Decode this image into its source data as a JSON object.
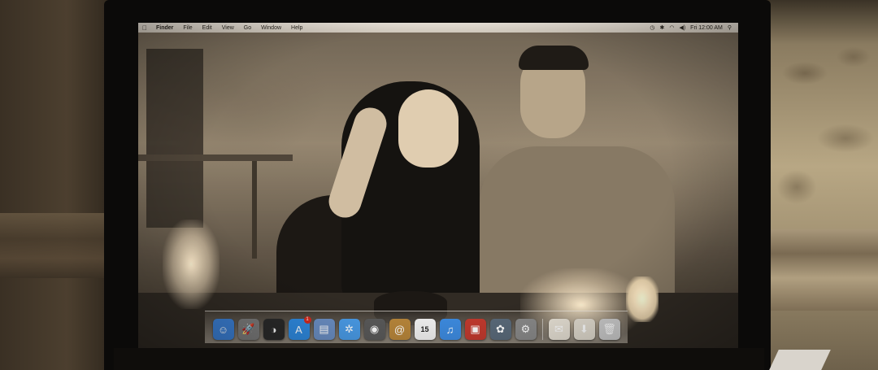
{
  "menubar": {
    "apple_icon": "apple-logo-icon",
    "items": [
      "Finder",
      "File",
      "Edit",
      "View",
      "Go",
      "Window",
      "Help"
    ],
    "status": {
      "clock": "Fri 12:00 AM",
      "icons": [
        "time-machine-icon",
        "bluetooth-icon",
        "wifi-icon",
        "volume-icon",
        "spotlight-icon"
      ]
    }
  },
  "wallpaper": {
    "description_icon": "photo-wallpaper"
  },
  "dock": {
    "items": [
      {
        "name": "finder",
        "icon": "☺",
        "color": "#3b7fd4"
      },
      {
        "name": "launchpad",
        "icon": "🚀",
        "color": "#7a7a7a"
      },
      {
        "name": "dashboard",
        "icon": "◑",
        "color": "#2a2a2a"
      },
      {
        "name": "app-store",
        "icon": "A",
        "color": "#2f8ae0",
        "badge": "1"
      },
      {
        "name": "preview",
        "icon": "▤",
        "color": "#6b8fc4"
      },
      {
        "name": "safari",
        "icon": "✲",
        "color": "#4a9ce8"
      },
      {
        "name": "facetime",
        "icon": "◉",
        "color": "#5a5a5a"
      },
      {
        "name": "contacts",
        "icon": "@",
        "color": "#b8863a"
      },
      {
        "name": "calendar",
        "icon": "15",
        "color": "#f1f1f1"
      },
      {
        "name": "itunes",
        "icon": "♫",
        "color": "#3d8be0"
      },
      {
        "name": "photo-booth",
        "icon": "▣",
        "color": "#c23a2e"
      },
      {
        "name": "iphoto",
        "icon": "✿",
        "color": "#5a6a7a"
      },
      {
        "name": "system-preferences",
        "icon": "⚙",
        "color": "#8a8a8a"
      },
      {
        "name": "documents",
        "icon": "✉",
        "color": "#e8e2d6"
      },
      {
        "name": "downloads",
        "icon": "⬇",
        "color": "#e3ddd1"
      },
      {
        "name": "trash",
        "icon": "🗑",
        "color": "#cfcfcf"
      }
    ]
  }
}
